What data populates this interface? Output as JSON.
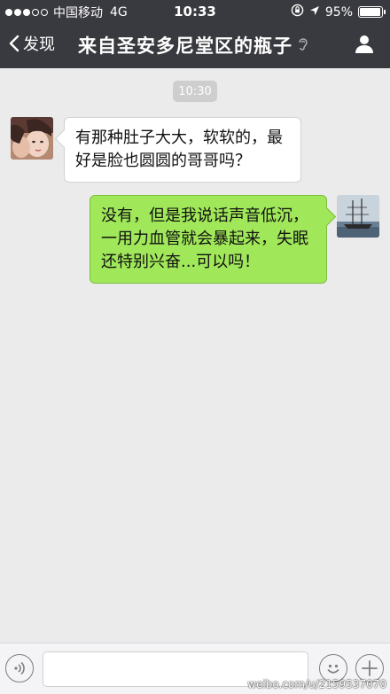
{
  "status_bar": {
    "carrier": "中国移动",
    "network": "4G",
    "time": "10:33",
    "battery_text": "95%",
    "battery_level": 0.95
  },
  "nav": {
    "back_label": "发现",
    "title": "来自圣安多尼堂区的瓶子"
  },
  "chat": {
    "timestamp": "10:30",
    "messages": [
      {
        "side": "left",
        "text": "有那种肚子大大，软软的，最好是脸也圆圆的哥哥吗？"
      },
      {
        "side": "right",
        "text": "没有，但是我说话声音低沉，一用力血管就会暴起来，失眠还特别兴奋...可以吗！"
      }
    ]
  },
  "input": {
    "value": ""
  },
  "watermark": "weibo.com/u/2159537070",
  "colors": {
    "nav_bg": "#393a3f",
    "chat_bg": "#ebebeb",
    "sent_bubble": "#a0e75a",
    "received_bubble": "#ffffff"
  }
}
